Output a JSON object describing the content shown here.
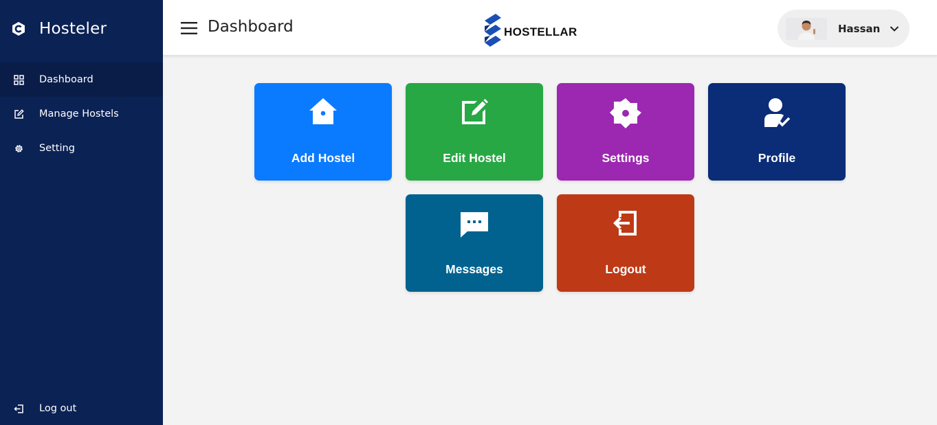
{
  "sidebar": {
    "brand": "Hosteler",
    "items": [
      {
        "label": "Dashboard",
        "icon": "grid-icon",
        "active": true
      },
      {
        "label": "Manage Hostels",
        "icon": "edit-icon",
        "active": false
      },
      {
        "label": "Setting",
        "icon": "gear-icon",
        "active": false
      }
    ],
    "logout_label": "Log out"
  },
  "header": {
    "title": "Dashboard",
    "logo_text": "HOSTELLAR",
    "user_name": "Hassan"
  },
  "tiles": [
    {
      "label": "Add Hostel",
      "icon": "house-icon",
      "color": "#0a7bff"
    },
    {
      "label": "Edit Hostel",
      "icon": "edit-square-icon",
      "color": "#28a745"
    },
    {
      "label": "Settings",
      "icon": "gear-icon",
      "color": "#9c27b0"
    },
    {
      "label": "Profile",
      "icon": "user-check-icon",
      "color": "#0b2d78"
    },
    {
      "label": "Messages",
      "icon": "chat-icon",
      "color": "#01628f"
    },
    {
      "label": "Logout",
      "icon": "logout-icon",
      "color": "#be3916"
    }
  ],
  "colors": {
    "sidebar_bg": "#0b2255",
    "sidebar_active": "#0a1d49",
    "content_bg": "#f3f3f3"
  }
}
